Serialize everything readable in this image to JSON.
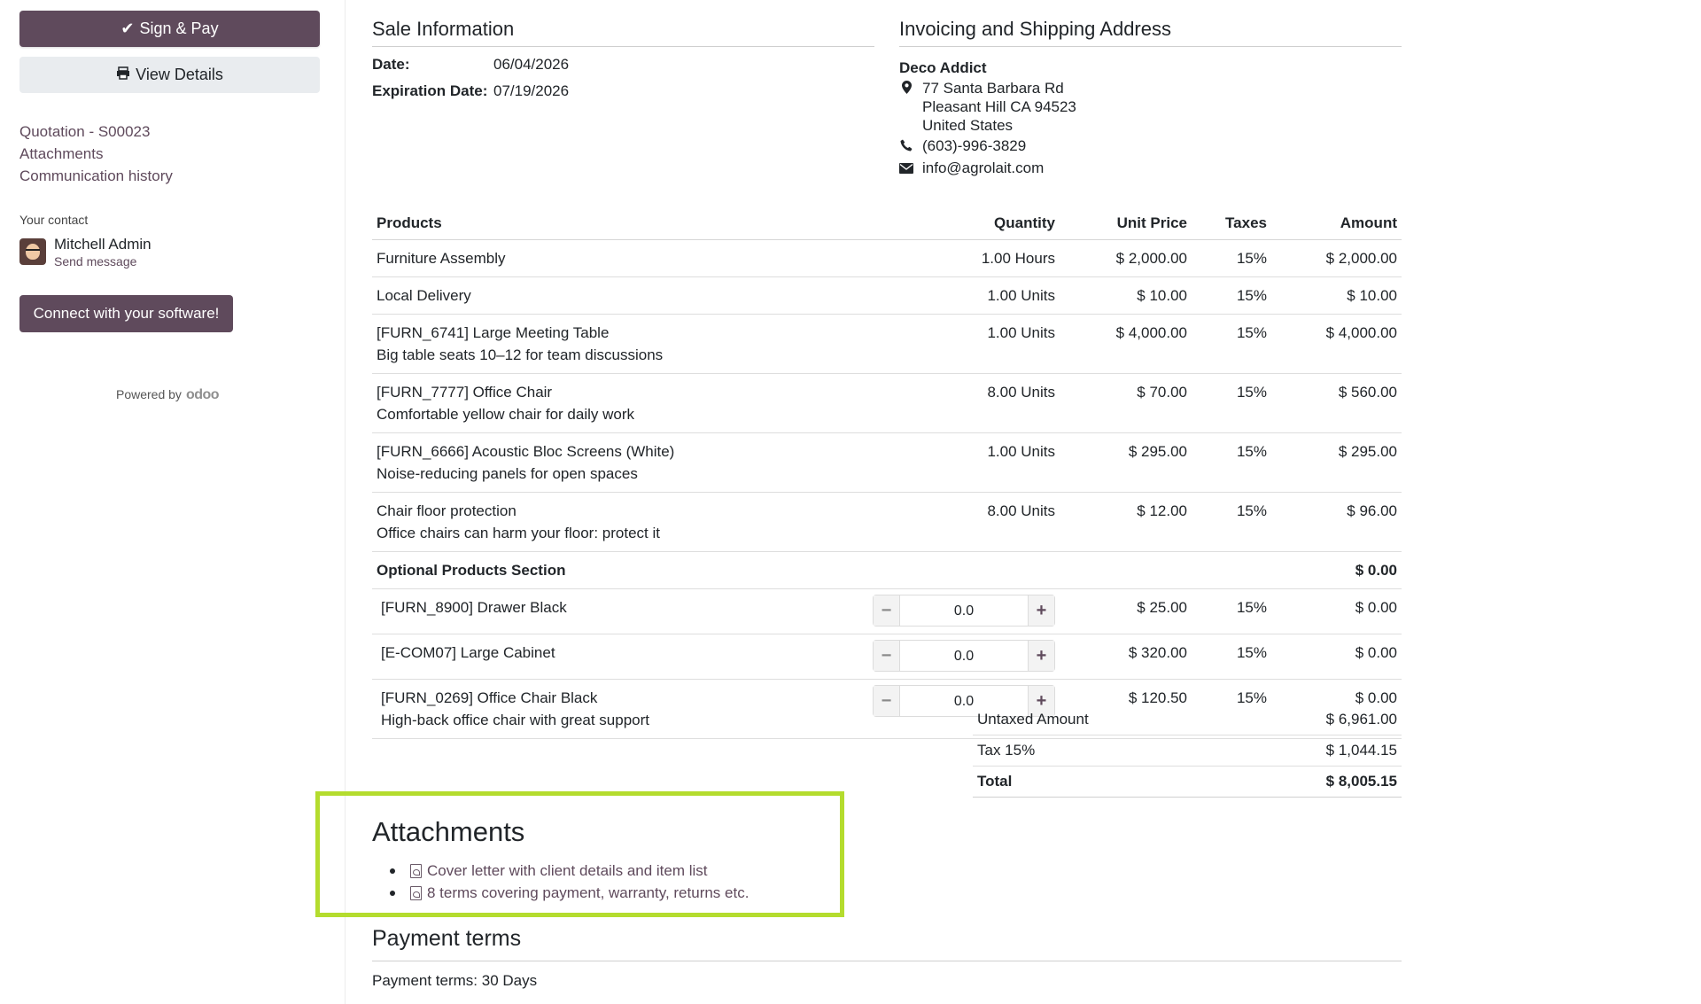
{
  "sidebar": {
    "sign_pay_label": "Sign & Pay",
    "view_details_label": "View Details",
    "links": [
      "Quotation - S00023",
      "Attachments",
      "Communication history"
    ],
    "contact_title": "Your contact",
    "contact_name": "Mitchell Admin",
    "contact_msg": "Send message",
    "connect_label": "Connect with your software!",
    "powered_by": "Powered by",
    "odoo": "odoo"
  },
  "sale_info": {
    "title": "Sale Information",
    "date_label": "Date:",
    "date_value": "06/04/2026",
    "exp_label": "Expiration Date:",
    "exp_value": "07/19/2026"
  },
  "address": {
    "title": "Invoicing and Shipping Address",
    "name": "Deco Addict",
    "street": "77 Santa Barbara Rd",
    "city": "Pleasant Hill CA 94523",
    "country": "United States",
    "phone": "(603)-996-3829",
    "email": "info@agrolait.com"
  },
  "table": {
    "headers": {
      "products": "Products",
      "quantity": "Quantity",
      "unit_price": "Unit Price",
      "taxes": "Taxes",
      "amount": "Amount"
    },
    "rows": [
      {
        "name": "Furniture Assembly",
        "desc": "",
        "qty": "1.00 Hours",
        "price": "$ 2,000.00",
        "tax": "15%",
        "amount": "$ 2,000.00"
      },
      {
        "name": "Local Delivery",
        "desc": "",
        "qty": "1.00 Units",
        "price": "$ 10.00",
        "tax": "15%",
        "amount": "$ 10.00"
      },
      {
        "name": "[FURN_6741] Large Meeting Table",
        "desc": "Big table seats 10–12 for team discussions",
        "qty": "1.00 Units",
        "price": "$ 4,000.00",
        "tax": "15%",
        "amount": "$ 4,000.00"
      },
      {
        "name": "[FURN_7777] Office Chair",
        "desc": "Comfortable yellow chair for daily work",
        "qty": "8.00 Units",
        "price": "$ 70.00",
        "tax": "15%",
        "amount": "$ 560.00"
      },
      {
        "name": "[FURN_6666] Acoustic Bloc Screens (White)",
        "desc": "Noise-reducing panels for open spaces",
        "qty": "1.00 Units",
        "price": "$ 295.00",
        "tax": "15%",
        "amount": "$ 295.00"
      },
      {
        "name": "Chair floor protection",
        "desc": "Office chairs can harm your floor: protect it",
        "qty": "8.00 Units",
        "price": "$ 12.00",
        "tax": "15%",
        "amount": "$ 96.00"
      }
    ],
    "optional_section": {
      "label": "Optional Products Section",
      "amount": "$ 0.00"
    },
    "optional_rows": [
      {
        "name": "[FURN_8900] Drawer Black",
        "desc": "",
        "qty": "0.0",
        "price": "$ 25.00",
        "tax": "15%",
        "amount": "$ 0.00"
      },
      {
        "name": "[E-COM07] Large Cabinet",
        "desc": "",
        "qty": "0.0",
        "price": "$ 320.00",
        "tax": "15%",
        "amount": "$ 0.00"
      },
      {
        "name": "[FURN_0269] Office Chair Black",
        "desc": "High-back office chair with great support",
        "qty": "0.0",
        "price": "$ 120.50",
        "tax": "15%",
        "amount": "$ 0.00"
      }
    ]
  },
  "totals": {
    "untaxed_label": "Untaxed Amount",
    "untaxed": "$ 6,961.00",
    "tax_label": "Tax 15%",
    "tax": "$ 1,044.15",
    "total_label": "Total",
    "total": "$ 8,005.15"
  },
  "attachments": {
    "title": "Attachments",
    "items": [
      "Cover letter with client details and item list",
      "8 terms covering payment, warranty, returns etc."
    ]
  },
  "payment": {
    "title": "Payment terms",
    "text": "Payment terms: 30 Days"
  },
  "colors": {
    "accent": "#5f4a5c",
    "highlight": "#b4dc2e"
  }
}
